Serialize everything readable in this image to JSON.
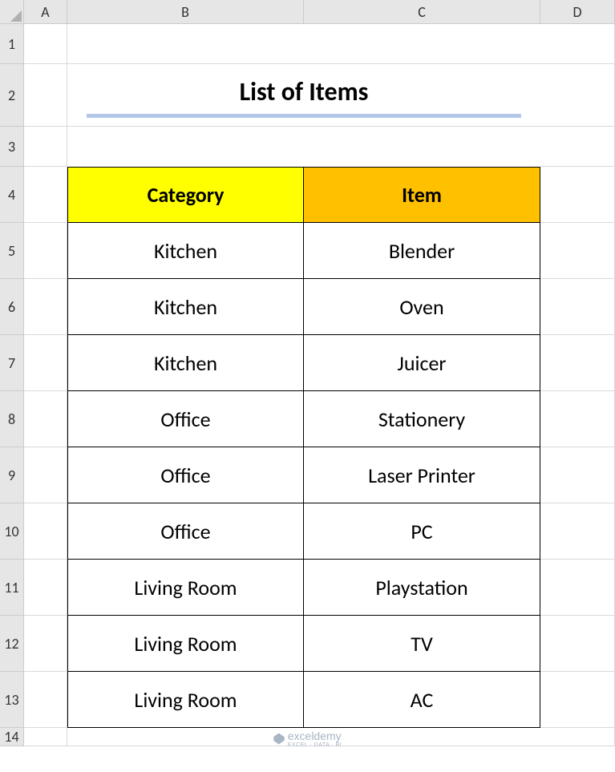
{
  "columns": [
    "A",
    "B",
    "C",
    "D"
  ],
  "rows": [
    "1",
    "2",
    "3",
    "4",
    "5",
    "6",
    "7",
    "8",
    "9",
    "10",
    "11",
    "12",
    "13",
    "14"
  ],
  "title": "List of Items",
  "headers": {
    "category": "Category",
    "item": "Item"
  },
  "chart_data": {
    "type": "table",
    "title": "List of Items",
    "columns": [
      "Category",
      "Item"
    ],
    "rows": [
      [
        "Kitchen",
        "Blender"
      ],
      [
        "Kitchen",
        "Oven"
      ],
      [
        "Kitchen",
        "Juicer"
      ],
      [
        "Office",
        "Stationery"
      ],
      [
        "Office",
        "Laser Printer"
      ],
      [
        "Office",
        "PC"
      ],
      [
        "Living Room",
        "Playstation"
      ],
      [
        "Living Room",
        "TV"
      ],
      [
        "Living Room",
        "AC"
      ]
    ]
  },
  "colors": {
    "header_category_bg": "#ffff00",
    "header_item_bg": "#ffc000",
    "title_underline": "#b4c7e7"
  },
  "watermark": {
    "brand": "exceldemy",
    "tagline": "EXCEL · DATA · BI"
  }
}
